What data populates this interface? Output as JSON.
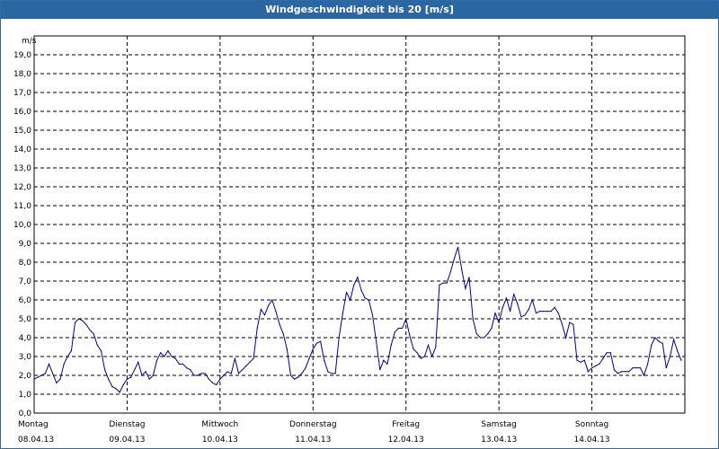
{
  "window": {
    "title": "Windgeschwindigkeit bis 20 [m/s]"
  },
  "colors": {
    "title_bar": "#2a66a1",
    "series_line": "#00008b",
    "grid": "#000000"
  },
  "chart_data": {
    "type": "line",
    "title": "Windgeschwindigkeit bis 20 [m/s]",
    "ylabel": "m/s",
    "ylim": [
      0,
      20
    ],
    "y_ticks": [
      "0,0",
      "1,0",
      "2,0",
      "3,0",
      "4,0",
      "5,0",
      "6,0",
      "7,0",
      "8,0",
      "9,0",
      "10,0",
      "11,0",
      "12,0",
      "13,0",
      "14,0",
      "15,0",
      "16,0",
      "17,0",
      "18,0",
      "19,0"
    ],
    "x_unit": "day",
    "xlim": [
      0,
      7
    ],
    "grid": true,
    "x_ticks": [
      {
        "day": "Montag",
        "date": "08.04.13"
      },
      {
        "day": "Dienstag",
        "date": "09.04.13"
      },
      {
        "day": "Mittwoch",
        "date": "10.04.13"
      },
      {
        "day": "Donnerstag",
        "date": "11.04.13"
      },
      {
        "day": "Freitag",
        "date": "12.04.13"
      },
      {
        "day": "Samstag",
        "date": "13.04.13"
      },
      {
        "day": "Sonntag",
        "date": "14.04.13"
      }
    ],
    "series": [
      {
        "x": [
          0,
          0.04,
          0.08,
          0.12,
          0.16,
          0.2,
          0.24,
          0.28,
          0.32,
          0.36,
          0.4,
          0.44,
          0.48,
          0.52,
          0.56,
          0.6,
          0.64,
          0.68,
          0.72,
          0.76,
          0.8,
          0.84,
          0.88,
          0.92,
          0.96,
          1.0,
          1.04,
          1.08,
          1.12,
          1.16,
          1.2,
          1.24,
          1.28,
          1.32,
          1.36,
          1.4,
          1.44,
          1.48,
          1.52,
          1.56,
          1.6,
          1.64,
          1.68,
          1.72,
          1.76,
          1.8,
          1.84,
          1.88,
          1.92,
          1.96,
          2.0,
          2.04,
          2.08,
          2.12,
          2.16,
          2.2,
          2.24,
          2.28,
          2.32,
          2.36,
          2.4,
          2.44,
          2.48,
          2.52,
          2.56,
          2.6,
          2.64,
          2.68,
          2.72,
          2.76,
          2.8,
          2.84,
          2.88,
          2.92,
          2.96,
          3.0,
          3.04,
          3.08,
          3.12,
          3.16,
          3.2,
          3.24,
          3.28,
          3.32,
          3.36,
          3.4,
          3.44,
          3.48,
          3.52,
          3.56,
          3.6,
          3.64,
          3.68,
          3.72,
          3.76,
          3.8,
          3.84,
          3.88,
          3.92,
          3.96,
          4.0,
          4.04,
          4.08,
          4.12,
          4.16,
          4.2,
          4.24,
          4.28,
          4.32,
          4.36,
          4.4,
          4.44,
          4.48,
          4.52,
          4.56,
          4.6,
          4.64,
          4.68,
          4.72,
          4.76,
          4.8,
          4.84,
          4.88,
          4.92,
          4.96,
          5.0,
          5.04,
          5.08,
          5.12,
          5.16,
          5.2,
          5.24,
          5.28,
          5.32,
          5.36,
          5.4,
          5.44,
          5.48,
          5.52,
          5.56,
          5.6,
          5.64,
          5.68,
          5.72,
          5.76,
          5.8,
          5.84,
          5.88,
          5.92,
          5.96,
          6.0,
          6.04,
          6.08,
          6.12,
          6.16,
          6.2,
          6.24,
          6.28,
          6.32,
          6.36,
          6.4,
          6.44,
          6.48,
          6.52,
          6.56,
          6.6,
          6.64,
          6.68,
          6.72,
          6.76,
          6.8,
          6.84,
          6.88,
          6.92,
          6.96
        ],
        "values": [
          1.8,
          1.9,
          2.0,
          2.1,
          2.6,
          2.1,
          1.6,
          1.8,
          2.6,
          3.0,
          3.3,
          4.8,
          5.0,
          4.9,
          4.7,
          4.4,
          4.2,
          3.6,
          3.3,
          2.3,
          1.8,
          1.4,
          1.3,
          1.1,
          1.5,
          1.8,
          1.9,
          2.3,
          2.7,
          2.0,
          2.2,
          1.8,
          2.0,
          2.8,
          3.2,
          3.0,
          3.3,
          3.0,
          2.9,
          2.6,
          2.6,
          2.4,
          2.3,
          2.0,
          2.0,
          2.1,
          2.1,
          1.8,
          1.6,
          1.5,
          1.8,
          2.0,
          2.2,
          2.1,
          2.9,
          2.1,
          2.3,
          2.5,
          2.7,
          2.9,
          4.5,
          5.5,
          5.2,
          5.7,
          6.0,
          5.4,
          4.7,
          4.2,
          3.4,
          2.0,
          1.8,
          1.9,
          2.1,
          2.4,
          2.9,
          3.4,
          3.7,
          3.8,
          2.8,
          2.2,
          2.1,
          2.1,
          4.0,
          5.3,
          6.4,
          6.0,
          6.8,
          7.2,
          6.5,
          6.1,
          6.0,
          5.2,
          3.8,
          2.3,
          2.8,
          2.6,
          3.6,
          4.3,
          4.5,
          4.5,
          5.0,
          4.1,
          3.4,
          3.2,
          2.9,
          3.0,
          3.6,
          3.0,
          3.5,
          6.8,
          6.9,
          6.9,
          7.5,
          8.2,
          8.8,
          7.6,
          6.6,
          7.2,
          5.0,
          4.2,
          4.0,
          4.0,
          4.2,
          4.5,
          5.3,
          4.8,
          5.6,
          6.1,
          5.4,
          6.3,
          5.8,
          5.1,
          5.2,
          5.5,
          6.0,
          5.3,
          5.4,
          5.4,
          5.4,
          5.4,
          5.6,
          5.3,
          4.7,
          4.0,
          4.8,
          4.7,
          2.8,
          2.7,
          2.8,
          2.2,
          2.4,
          2.5,
          2.6,
          2.9,
          3.2,
          3.2,
          2.3,
          2.1,
          2.2,
          2.2,
          2.2,
          2.4,
          2.4,
          2.4,
          2.0,
          2.6,
          3.6,
          4.0,
          3.8,
          3.7,
          2.4,
          3.0,
          3.9,
          3.3,
          2.8
        ]
      }
    ]
  }
}
